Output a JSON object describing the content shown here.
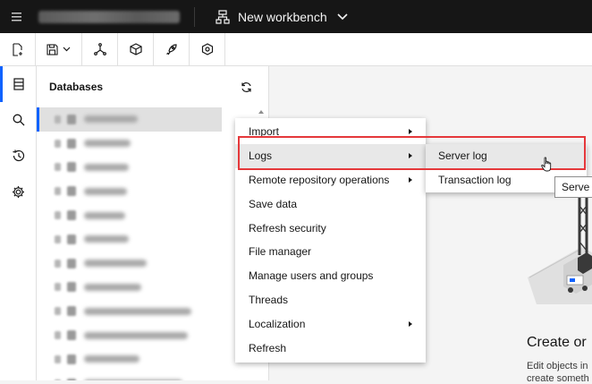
{
  "header": {
    "connection_name": "",
    "workbench_label": "New workbench"
  },
  "toolbar": {
    "buttons": [
      "new-script",
      "save",
      "graph-explorer",
      "model",
      "deploy",
      "settings-hex"
    ]
  },
  "rail": {
    "items": [
      "databases-icon",
      "search-icon",
      "history-icon",
      "gear-icon"
    ]
  },
  "databases_panel": {
    "title": "Databases",
    "refresh_icon": "refresh-icon",
    "tree_row_count": 11
  },
  "context_menu": {
    "items": [
      {
        "label": "Import",
        "has_submenu": true
      },
      {
        "label": "Logs",
        "has_submenu": true
      },
      {
        "label": "Remote repository operations",
        "has_submenu": true
      },
      {
        "label": "Save data",
        "has_submenu": false
      },
      {
        "label": "Refresh security",
        "has_submenu": false
      },
      {
        "label": "File manager",
        "has_submenu": false
      },
      {
        "label": "Manage users and groups",
        "has_submenu": false
      },
      {
        "label": "Threads",
        "has_submenu": false
      },
      {
        "label": "Localization",
        "has_submenu": true
      },
      {
        "label": "Refresh",
        "has_submenu": false
      }
    ]
  },
  "logs_submenu": {
    "items": [
      {
        "label": "Server log"
      },
      {
        "label": "Transaction log"
      }
    ]
  },
  "tooltip": {
    "text": "Serve"
  },
  "main": {
    "create_title": "Create or",
    "create_desc_line1": "Edit objects in",
    "create_desc_line2": "create someth"
  },
  "colors": {
    "accent": "#0f62fe",
    "highlight_box": "#e5383b",
    "topbar": "#161616"
  }
}
